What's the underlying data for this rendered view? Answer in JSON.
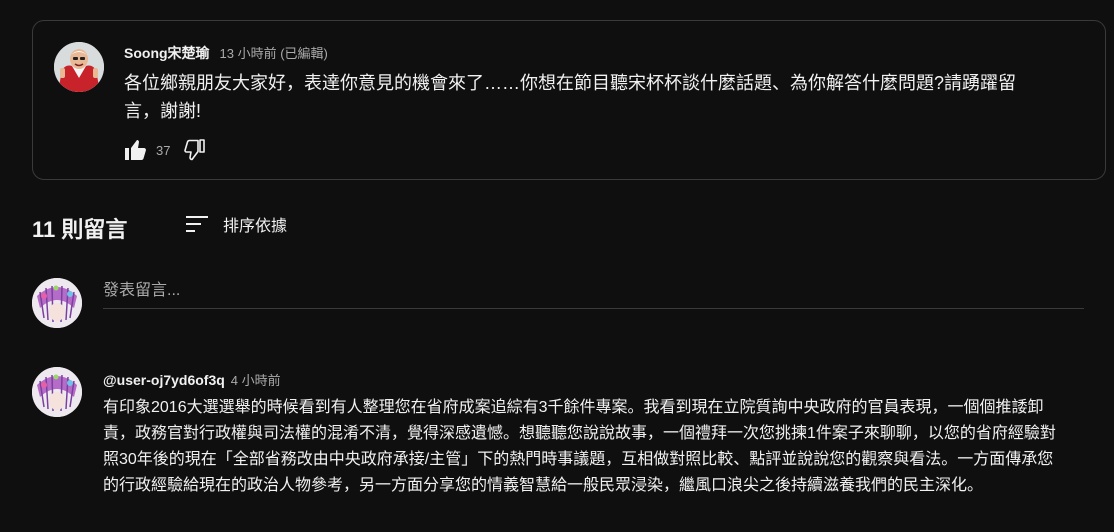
{
  "pinned_comment": {
    "author": "Soong宋楚瑜",
    "time": "13 小時前 (已編輯)",
    "text": "各位鄉親朋友大家好，表達你意見的機會來了……你想在節目聽宋杯杯談什麼話題、為你解答什麼問題?請踴躍留言，謝謝!",
    "like_count": "37"
  },
  "comments_header": {
    "count_label": "11 則留言",
    "sort_label": "排序依據"
  },
  "add_comment": {
    "placeholder": "發表留言..."
  },
  "comments": [
    {
      "author": "@user-oj7yd6of3q",
      "time": "4 小時前",
      "text": "有印象2016大選選舉的時候看到有人整理您在省府成案追綜有3千餘件專案。我看到現在立院質詢中央政府的官員表現，一個個推諉卸責，政務官對行政權與司法權的混淆不清，覺得深感遺憾。想聽聽您說說故事，一個禮拜一次您挑揀1件案子來聊聊，以您的省府經驗對照30年後的現在「全部省務改由中央政府承接/主管」下的熱門時事議題，互相做對照比較、點評並說說您的觀察與看法。一方面傳承您的行政經驗給現在的政治人物參考，另一方面分享您的情義智慧給一般民眾浸染，繼風口浪尖之後持續滋養我們的民主深化。"
    }
  ]
}
